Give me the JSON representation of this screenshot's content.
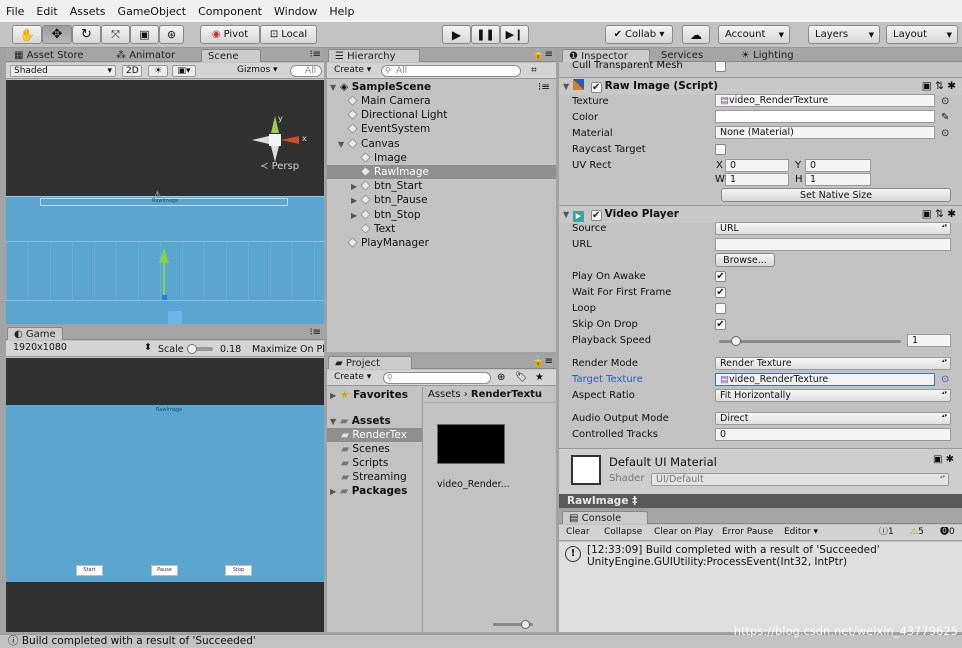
{
  "menu": [
    "File",
    "Edit",
    "Assets",
    "GameObject",
    "Component",
    "Window",
    "Help"
  ],
  "toolbar": {
    "tools": [
      "hand-icon",
      "move-icon",
      "rotate-icon",
      "scale-icon",
      "rect-icon",
      "transform-icon"
    ],
    "pivot_label": "Pivot",
    "local_label": "Local",
    "play_icons": [
      "play-icon",
      "pause-icon",
      "step-icon"
    ],
    "collab_label": "Collab ▾",
    "account_label": "Account",
    "layers_label": "Layers",
    "layout_label": "Layout"
  },
  "scene_panel": {
    "tabs": [
      "Asset Store",
      "Animator",
      "Scene"
    ],
    "shading": "Shaded",
    "mode_2d": "2D",
    "gizmos_label": "Gizmos ▾",
    "search_placeholder": "All",
    "persp_label": "Persp",
    "gizmo_axes": [
      "y",
      "x"
    ],
    "canvas_label": "RawImage"
  },
  "game_panel": {
    "tab": "Game",
    "resolution": "1920x1080",
    "scale_label": "Scale",
    "scale_value": "0.18",
    "maximize_label": "Maximize On Pl",
    "buttons": [
      "Start",
      "Pause",
      "Stop"
    ],
    "top_text": "RawImage"
  },
  "hierarchy": {
    "tab": "Hierarchy",
    "create_label": "Create ▾",
    "search_placeholder": "All",
    "scene_name": "SampleScene",
    "items": [
      {
        "label": "Main Camera",
        "indent": 1,
        "expand": ""
      },
      {
        "label": "Directional Light",
        "indent": 1,
        "expand": ""
      },
      {
        "label": "EventSystem",
        "indent": 1,
        "expand": ""
      },
      {
        "label": "Canvas",
        "indent": 1,
        "expand": "▼"
      },
      {
        "label": "Image",
        "indent": 2,
        "expand": ""
      },
      {
        "label": "RawImage",
        "indent": 2,
        "expand": "",
        "selected": true
      },
      {
        "label": "btn_Start",
        "indent": 2,
        "expand": "▶"
      },
      {
        "label": "btn_Pause",
        "indent": 2,
        "expand": "▶"
      },
      {
        "label": "btn_Stop",
        "indent": 2,
        "expand": "▶"
      },
      {
        "label": "Text",
        "indent": 2,
        "expand": ""
      },
      {
        "label": "PlayManager",
        "indent": 1,
        "expand": ""
      }
    ]
  },
  "project": {
    "tab": "Project",
    "create_label": "Create ▾",
    "favorites": "Favorites",
    "assets": "Assets",
    "folders": [
      "RenderTex",
      "Scenes",
      "Scripts",
      "Streaming"
    ],
    "packages": "Packages",
    "breadcrumb": [
      "Assets",
      "RenderTextu"
    ],
    "asset_name": "video_Render..."
  },
  "inspector": {
    "tabs": [
      "Inspector",
      "Services",
      "Lighting"
    ],
    "cull_label": "Cull Transparent Mesh",
    "raw_image": {
      "title": "Raw Image (Script)",
      "texture_label": "Texture",
      "texture_value": "video_RenderTexture",
      "color_label": "Color",
      "material_label": "Material",
      "material_value": "None (Material)",
      "raycast_label": "Raycast Target",
      "uvrect_label": "UV Rect",
      "uv": {
        "x": "0",
        "y": "0",
        "w": "1",
        "h": "1"
      },
      "native_size_label": "Set Native Size"
    },
    "video_player": {
      "title": "Video Player",
      "source_label": "Source",
      "source_value": "URL",
      "url_label": "URL",
      "url_value": "",
      "browse_label": "Browse...",
      "play_on_awake_label": "Play On Awake",
      "play_on_awake": true,
      "wait_first_frame_label": "Wait For First Frame",
      "wait_first_frame": true,
      "loop_label": "Loop",
      "loop": false,
      "skip_on_drop_label": "Skip On Drop",
      "skip_on_drop": true,
      "speed_label": "Playback Speed",
      "speed_value": "1",
      "render_mode_label": "Render Mode",
      "render_mode_value": "Render Texture",
      "target_texture_label": "Target Texture",
      "target_texture_value": "video_RenderTexture",
      "aspect_label": "Aspect Ratio",
      "aspect_value": "Fit Horizontally",
      "audio_mode_label": "Audio Output Mode",
      "audio_mode_value": "Direct",
      "tracks_label": "Controlled Tracks",
      "tracks_value": "0"
    },
    "material": {
      "title": "Default UI Material",
      "shader_label": "Shader",
      "shader_value": "UI/Default"
    },
    "preview_label": "RawImage ‡"
  },
  "console": {
    "tab": "Console",
    "buttons": [
      "Clear",
      "Collapse",
      "Clear on Play",
      "Error Pause",
      "Editor ▾"
    ],
    "counts": {
      "info": "1",
      "warn": "5",
      "error": "0"
    },
    "message_line1": "[12:33:09] Build completed with a result of 'Succeeded'",
    "message_line2": "UnityEngine.GUIUtility:ProcessEvent(Int32, IntPtr)"
  },
  "status": "Build completed with a result of 'Succeeded'",
  "watermark": "https://blog.csdn.net/weixin_43779625",
  "colors": {
    "scene_blue": "#5aa6d1",
    "dark_bg": "#313131",
    "accent_link": "#2b5fbd"
  }
}
